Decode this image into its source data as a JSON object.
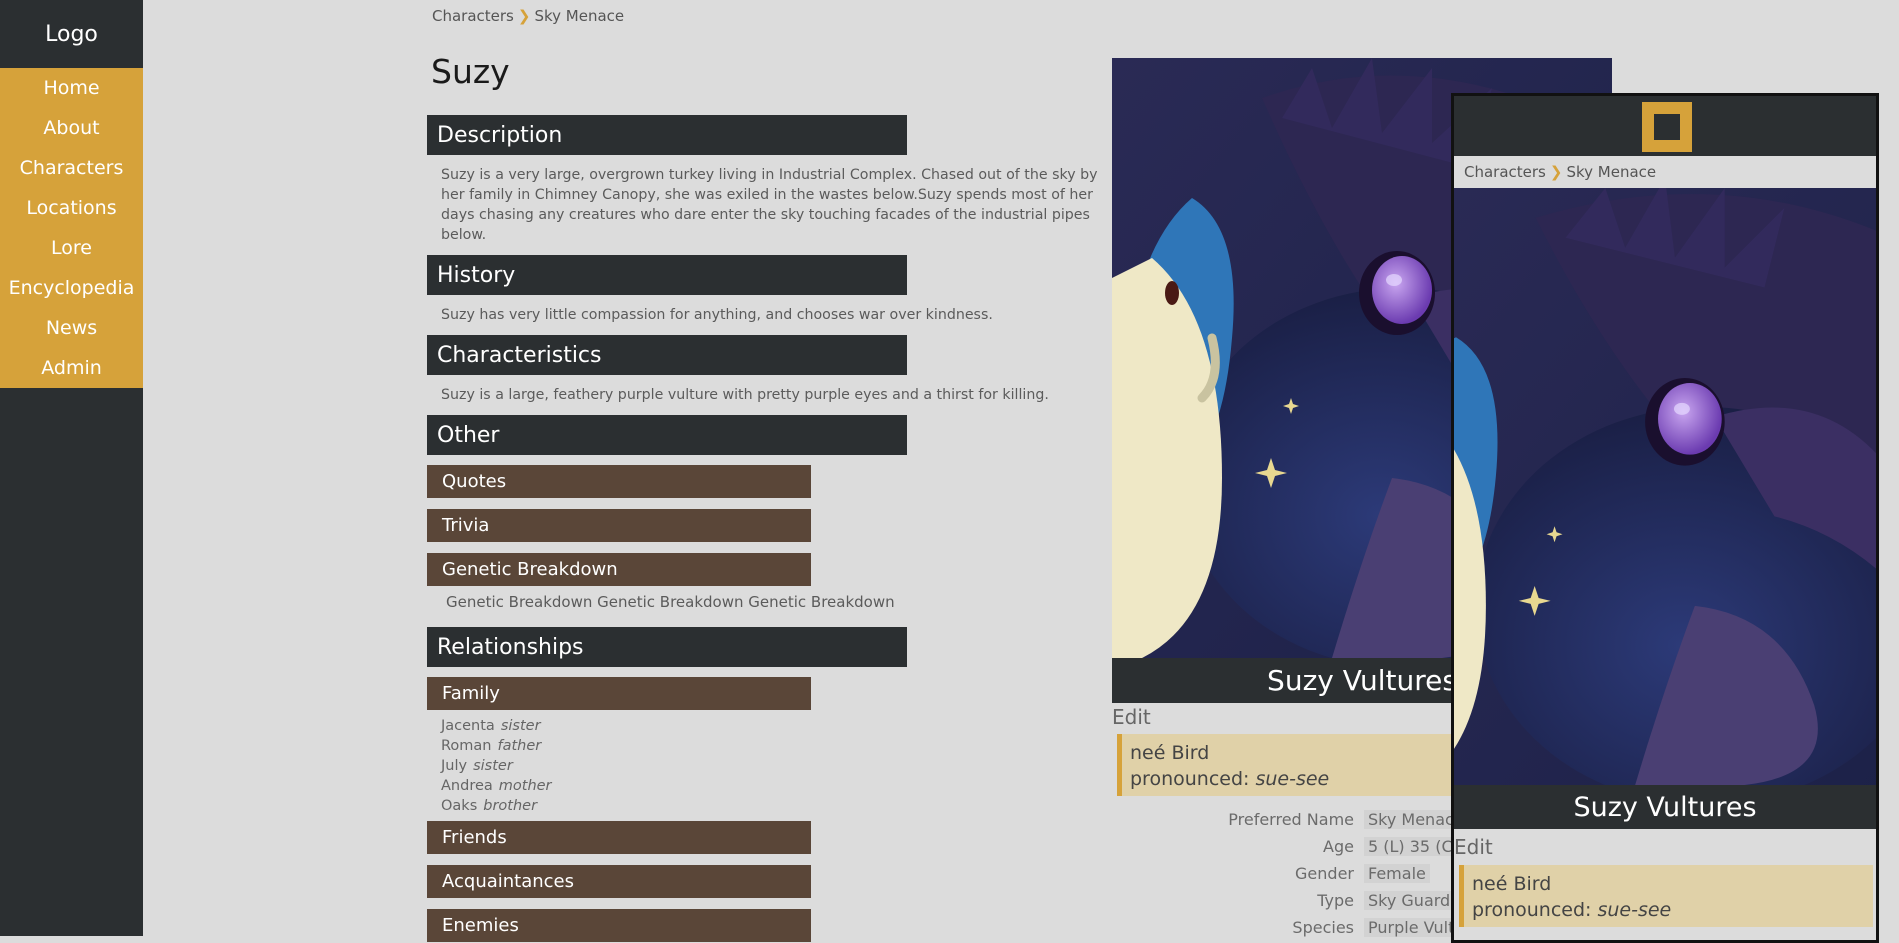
{
  "sidebar": {
    "logo": "Logo",
    "nav": [
      "Home",
      "About",
      "Characters",
      "Locations",
      "Lore",
      "Encyclopedia",
      "News",
      "Admin"
    ]
  },
  "breadcrumb": {
    "parent": "Characters",
    "current": "Sky Menace"
  },
  "character": {
    "title": "Suzy",
    "full_name": "Suzy Vultures",
    "edit_label": "Edit",
    "nee": "neé Bird",
    "pronounced_prefix": "pronounced: ",
    "pronounced": "sue-see"
  },
  "sections": {
    "description": {
      "heading": "Description",
      "text": "Suzy is a very large, overgrown turkey living in Industrial Complex.  Chased out of the sky by her family in Chimney Canopy, she was exiled in the wastes below.Suzy spends most of her days chasing any creatures who dare enter the sky touching facades of the industrial pipes below."
    },
    "history": {
      "heading": "History",
      "text": "Suzy has very little compassion for anything, and chooses war over kindness."
    },
    "characteristics": {
      "heading": "Characteristics",
      "text": "Suzy is a large, feathery purple vulture with pretty purple eyes and a thirst for killing."
    },
    "other": {
      "heading": "Other",
      "quotes": "Quotes",
      "trivia": "Trivia",
      "genetic": "Genetic Breakdown",
      "genetic_text": "Genetic Breakdown Genetic Breakdown Genetic Breakdown"
    },
    "relationships": {
      "heading": "Relationships",
      "family": "Family",
      "family_members": [
        {
          "name": "Jacenta",
          "role": "sister"
        },
        {
          "name": "Roman",
          "role": "father"
        },
        {
          "name": "July",
          "role": "sister"
        },
        {
          "name": "Andrea",
          "role": "mother"
        },
        {
          "name": "Oaks",
          "role": "brother"
        }
      ],
      "friends": "Friends",
      "acquaintances": "Acquaintances",
      "enemies": "Enemies"
    }
  },
  "info": {
    "preferred_name": {
      "label": "Preferred Name",
      "value": "Sky Menac"
    },
    "age": {
      "label": "Age",
      "value": "5 (L)  35 (C"
    },
    "gender": {
      "label": "Gender",
      "value": "Female"
    },
    "type": {
      "label": "Type",
      "value": "Sky Guard"
    },
    "species": {
      "label": "Species",
      "value": "Purple Vult"
    }
  },
  "colors": {
    "accent": "#d6a23a",
    "dark": "#2b2f31",
    "brown": "#5a4638",
    "background": "#dcdcdc"
  }
}
